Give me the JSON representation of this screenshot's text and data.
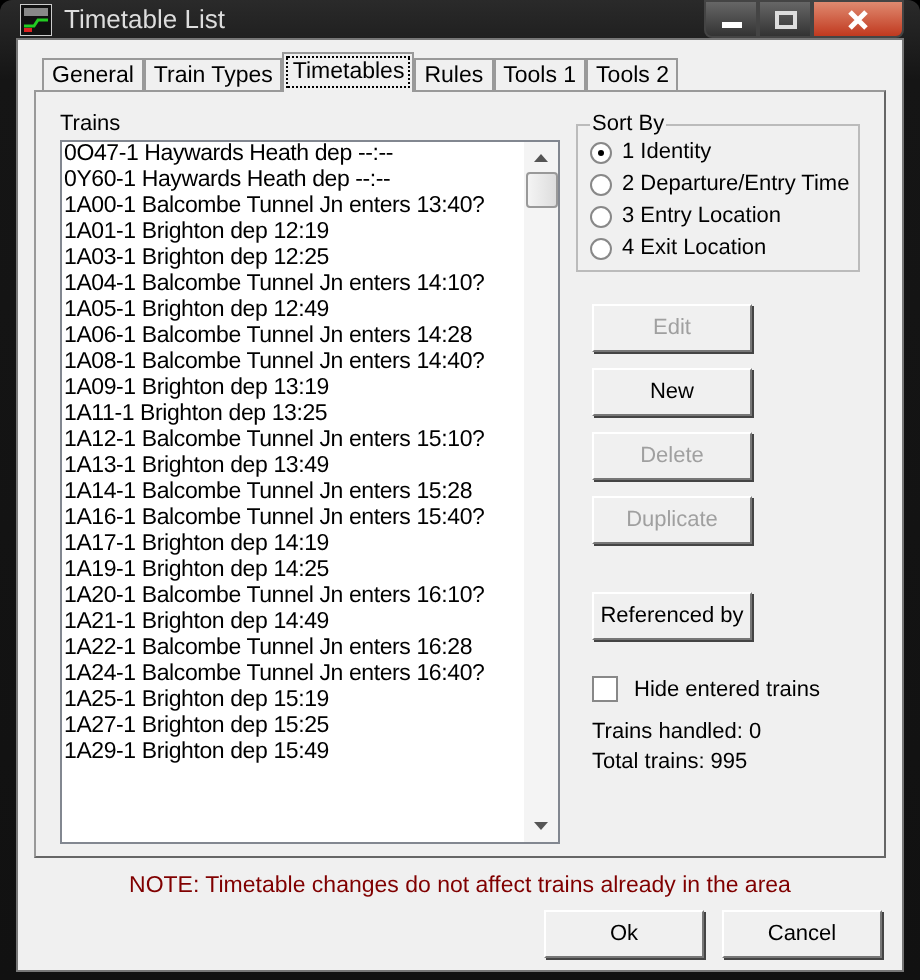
{
  "window": {
    "title": "Timetable List"
  },
  "tabs": [
    {
      "label": "General",
      "selected": false
    },
    {
      "label": "Train Types",
      "selected": false
    },
    {
      "label": "Timetables",
      "selected": true
    },
    {
      "label": "Rules",
      "selected": false
    },
    {
      "label": "Tools 1",
      "selected": false
    },
    {
      "label": "Tools 2",
      "selected": false
    }
  ],
  "trains": {
    "label": "Trains",
    "rows": [
      "0O47-1 Haywards Heath dep --:--",
      "0Y60-1 Haywards Heath dep --:--",
      "1A00-1 Balcombe Tunnel Jn enters 13:40?",
      "1A01-1 Brighton dep 12:19",
      "1A03-1 Brighton dep 12:25",
      "1A04-1 Balcombe Tunnel Jn enters 14:10?",
      "1A05-1 Brighton dep 12:49",
      "1A06-1 Balcombe Tunnel Jn enters 14:28",
      "1A08-1 Balcombe Tunnel Jn enters 14:40?",
      "1A09-1 Brighton dep 13:19",
      "1A11-1 Brighton dep 13:25",
      "1A12-1 Balcombe Tunnel Jn enters 15:10?",
      "1A13-1 Brighton dep 13:49",
      "1A14-1 Balcombe Tunnel Jn enters 15:28",
      "1A16-1 Balcombe Tunnel Jn enters 15:40?",
      "1A17-1 Brighton dep 14:19",
      "1A19-1 Brighton dep 14:25",
      "1A20-1 Balcombe Tunnel Jn enters 16:10?",
      "1A21-1 Brighton dep 14:49",
      "1A22-1 Balcombe Tunnel Jn enters 16:28",
      "1A24-1 Balcombe Tunnel Jn enters 16:40?",
      "1A25-1 Brighton dep 15:19",
      "1A27-1 Brighton dep 15:25",
      "1A29-1 Brighton dep 15:49"
    ]
  },
  "sort_by": {
    "label": "Sort By",
    "options": [
      {
        "label": "1 Identity",
        "selected": true
      },
      {
        "label": "2 Departure/Entry Time",
        "selected": false
      },
      {
        "label": "3 Entry Location",
        "selected": false
      },
      {
        "label": "4 Exit Location",
        "selected": false
      }
    ]
  },
  "actions": [
    {
      "label": "Edit",
      "disabled": true
    },
    {
      "label": "New",
      "disabled": false
    },
    {
      "label": "Delete",
      "disabled": true
    },
    {
      "label": "Duplicate",
      "disabled": true
    }
  ],
  "referenced_by": {
    "label": "Referenced by",
    "disabled": false
  },
  "hide_entered": {
    "label": "Hide entered trains",
    "checked": false
  },
  "stats": [
    "Trains handled: 0",
    "Total trains: 995"
  ],
  "note": "NOTE: Timetable changes do not affect trains already in the area",
  "dialog_buttons": [
    {
      "label": "Ok"
    },
    {
      "label": "Cancel"
    }
  ]
}
